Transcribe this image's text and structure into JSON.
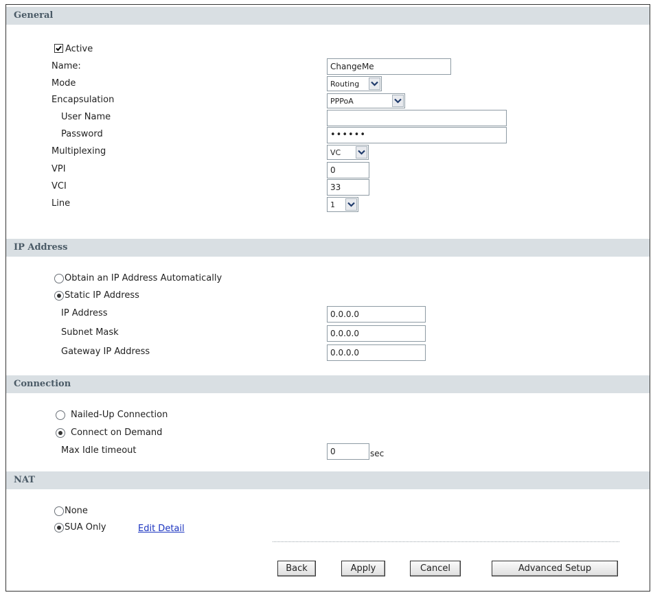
{
  "sections": {
    "general": "General",
    "ip_address": "IP Address",
    "connection": "Connection",
    "nat": "NAT"
  },
  "general": {
    "active_label": "Active",
    "active_checked": true,
    "name_label": "Name:",
    "name_value": "ChangeMe",
    "mode_label": "Mode",
    "mode_value": "Routing",
    "encapsulation_label": "Encapsulation",
    "encapsulation_value": "PPPoA",
    "user_name_label": "User Name",
    "user_name_value": "",
    "password_label": "Password",
    "password_value": "••••••",
    "multiplexing_label": "Multiplexing",
    "multiplexing_value": "VC",
    "vpi_label": "VPI",
    "vpi_value": "0",
    "vci_label": "VCI",
    "vci_value": "33",
    "line_label": "Line",
    "line_value": "1"
  },
  "ip": {
    "auto_label": "Obtain an IP Address Automatically",
    "static_label": "Static IP Address",
    "selected": "static",
    "ip_address_label": "IP Address",
    "ip_address_value": "0.0.0.0",
    "subnet_mask_label": "Subnet Mask",
    "subnet_mask_value": "0.0.0.0",
    "gateway_label": "Gateway IP Address",
    "gateway_value": "0.0.0.0"
  },
  "connection": {
    "nailed_up_label": "Nailed-Up Connection",
    "on_demand_label": "Connect on Demand",
    "selected": "on_demand",
    "max_idle_label": "Max Idle timeout",
    "max_idle_value": "0",
    "max_idle_unit": "sec"
  },
  "nat": {
    "none_label": "None",
    "sua_label": "SUA Only",
    "selected": "sua",
    "edit_detail_link": "Edit Detail"
  },
  "buttons": {
    "back": "Back",
    "apply": "Apply",
    "cancel": "Cancel",
    "advanced": "Advanced Setup"
  }
}
